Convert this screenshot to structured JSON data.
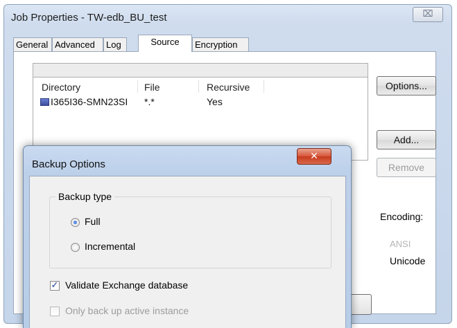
{
  "window": {
    "title": "Job Properties - TW-edb_BU_test",
    "close_glyph": "⌧"
  },
  "tabs": [
    {
      "label": "General"
    },
    {
      "label": "Advanced"
    },
    {
      "label": "Log"
    },
    {
      "label": "Source",
      "active": true
    },
    {
      "label": "Encryption"
    }
  ],
  "source_list": {
    "columns": [
      "Directory",
      "File",
      "Recursive"
    ],
    "rows": [
      {
        "directory": "I365I36-SMN23SI",
        "file": "*.*",
        "recursive": "Yes"
      }
    ]
  },
  "buttons": {
    "options": "Options...",
    "add": "Add...",
    "remove": "Remove"
  },
  "encoding": {
    "label": "Encoding:",
    "ansi": "ANSI",
    "unicode": "Unicode"
  },
  "dialog": {
    "title": "Backup Options",
    "close_glyph": "✕",
    "backup_type_label": "Backup type",
    "options": [
      {
        "label": "Full",
        "selected": true
      },
      {
        "label": "Incremental",
        "selected": false
      }
    ],
    "validate_label": "Validate Exchange database",
    "validate_checked": true,
    "active_only_label": "Only back up active instance",
    "active_only_enabled": false
  },
  "colors": {
    "window_chrome": "#cfdcee",
    "dialog_close": "#c73b1e",
    "disabled_text": "#9c9c9c"
  }
}
